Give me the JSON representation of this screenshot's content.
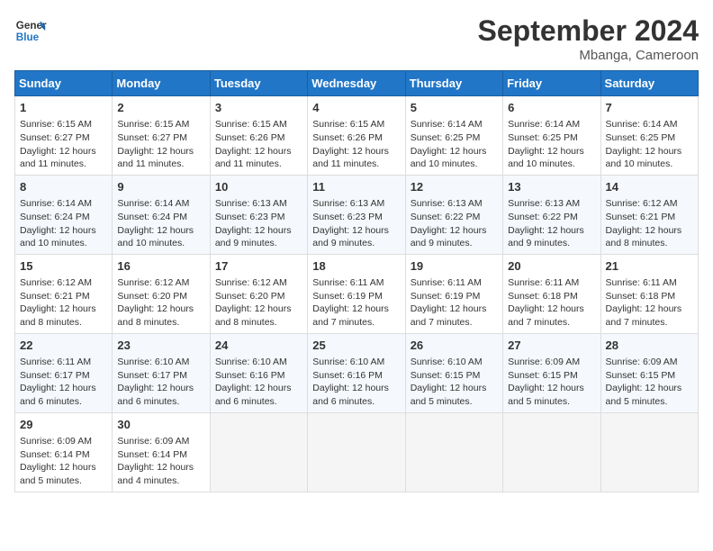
{
  "logo": {
    "line1": "General",
    "line2": "Blue"
  },
  "title": "September 2024",
  "subtitle": "Mbanga, Cameroon",
  "days_of_week": [
    "Sunday",
    "Monday",
    "Tuesday",
    "Wednesday",
    "Thursday",
    "Friday",
    "Saturday"
  ],
  "weeks": [
    [
      {
        "day": "1",
        "sunrise": "6:15 AM",
        "sunset": "6:27 PM",
        "daylight": "12 hours and 11 minutes."
      },
      {
        "day": "2",
        "sunrise": "6:15 AM",
        "sunset": "6:27 PM",
        "daylight": "12 hours and 11 minutes."
      },
      {
        "day": "3",
        "sunrise": "6:15 AM",
        "sunset": "6:26 PM",
        "daylight": "12 hours and 11 minutes."
      },
      {
        "day": "4",
        "sunrise": "6:15 AM",
        "sunset": "6:26 PM",
        "daylight": "12 hours and 11 minutes."
      },
      {
        "day": "5",
        "sunrise": "6:14 AM",
        "sunset": "6:25 PM",
        "daylight": "12 hours and 10 minutes."
      },
      {
        "day": "6",
        "sunrise": "6:14 AM",
        "sunset": "6:25 PM",
        "daylight": "12 hours and 10 minutes."
      },
      {
        "day": "7",
        "sunrise": "6:14 AM",
        "sunset": "6:25 PM",
        "daylight": "12 hours and 10 minutes."
      }
    ],
    [
      {
        "day": "8",
        "sunrise": "6:14 AM",
        "sunset": "6:24 PM",
        "daylight": "12 hours and 10 minutes."
      },
      {
        "day": "9",
        "sunrise": "6:14 AM",
        "sunset": "6:24 PM",
        "daylight": "12 hours and 10 minutes."
      },
      {
        "day": "10",
        "sunrise": "6:13 AM",
        "sunset": "6:23 PM",
        "daylight": "12 hours and 9 minutes."
      },
      {
        "day": "11",
        "sunrise": "6:13 AM",
        "sunset": "6:23 PM",
        "daylight": "12 hours and 9 minutes."
      },
      {
        "day": "12",
        "sunrise": "6:13 AM",
        "sunset": "6:22 PM",
        "daylight": "12 hours and 9 minutes."
      },
      {
        "day": "13",
        "sunrise": "6:13 AM",
        "sunset": "6:22 PM",
        "daylight": "12 hours and 9 minutes."
      },
      {
        "day": "14",
        "sunrise": "6:12 AM",
        "sunset": "6:21 PM",
        "daylight": "12 hours and 8 minutes."
      }
    ],
    [
      {
        "day": "15",
        "sunrise": "6:12 AM",
        "sunset": "6:21 PM",
        "daylight": "12 hours and 8 minutes."
      },
      {
        "day": "16",
        "sunrise": "6:12 AM",
        "sunset": "6:20 PM",
        "daylight": "12 hours and 8 minutes."
      },
      {
        "day": "17",
        "sunrise": "6:12 AM",
        "sunset": "6:20 PM",
        "daylight": "12 hours and 8 minutes."
      },
      {
        "day": "18",
        "sunrise": "6:11 AM",
        "sunset": "6:19 PM",
        "daylight": "12 hours and 7 minutes."
      },
      {
        "day": "19",
        "sunrise": "6:11 AM",
        "sunset": "6:19 PM",
        "daylight": "12 hours and 7 minutes."
      },
      {
        "day": "20",
        "sunrise": "6:11 AM",
        "sunset": "6:18 PM",
        "daylight": "12 hours and 7 minutes."
      },
      {
        "day": "21",
        "sunrise": "6:11 AM",
        "sunset": "6:18 PM",
        "daylight": "12 hours and 7 minutes."
      }
    ],
    [
      {
        "day": "22",
        "sunrise": "6:11 AM",
        "sunset": "6:17 PM",
        "daylight": "12 hours and 6 minutes."
      },
      {
        "day": "23",
        "sunrise": "6:10 AM",
        "sunset": "6:17 PM",
        "daylight": "12 hours and 6 minutes."
      },
      {
        "day": "24",
        "sunrise": "6:10 AM",
        "sunset": "6:16 PM",
        "daylight": "12 hours and 6 minutes."
      },
      {
        "day": "25",
        "sunrise": "6:10 AM",
        "sunset": "6:16 PM",
        "daylight": "12 hours and 6 minutes."
      },
      {
        "day": "26",
        "sunrise": "6:10 AM",
        "sunset": "6:15 PM",
        "daylight": "12 hours and 5 minutes."
      },
      {
        "day": "27",
        "sunrise": "6:09 AM",
        "sunset": "6:15 PM",
        "daylight": "12 hours and 5 minutes."
      },
      {
        "day": "28",
        "sunrise": "6:09 AM",
        "sunset": "6:15 PM",
        "daylight": "12 hours and 5 minutes."
      }
    ],
    [
      {
        "day": "29",
        "sunrise": "6:09 AM",
        "sunset": "6:14 PM",
        "daylight": "12 hours and 5 minutes."
      },
      {
        "day": "30",
        "sunrise": "6:09 AM",
        "sunset": "6:14 PM",
        "daylight": "12 hours and 4 minutes."
      },
      null,
      null,
      null,
      null,
      null
    ]
  ]
}
